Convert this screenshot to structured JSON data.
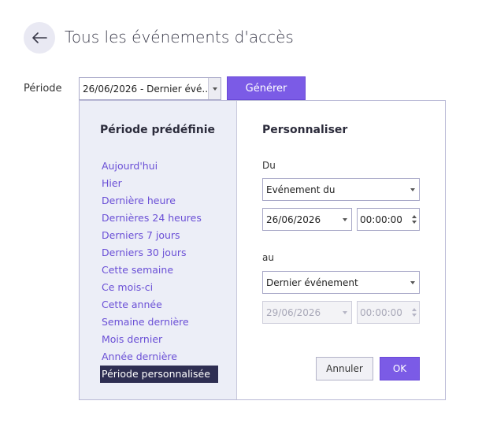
{
  "header": {
    "title": "Tous les événements d'accès",
    "back_icon": "arrow-left-icon"
  },
  "filter": {
    "period_label": "Période",
    "period_value": "26/06/2026 - Dernier évé...",
    "generate_label": "Générer"
  },
  "dropdown": {
    "presets_title": "Période prédéfinie",
    "presets": [
      "Aujourd'hui",
      "Hier",
      "Dernière heure",
      "Dernières 24 heures",
      "Derniers 7 jours",
      "Derniers 30 jours",
      "Cette semaine",
      "Ce mois-ci",
      "Cette année",
      "Semaine dernière",
      "Mois dernier",
      "Année dernière",
      "Période personnalisée"
    ],
    "selected_preset": "Période personnalisée",
    "custom": {
      "title": "Personnaliser",
      "from_label": "Du",
      "from_type": "Evénement du",
      "from_date": "26/06/2026",
      "from_time": "00:00:00",
      "to_label": "au",
      "to_type": "Dernier événement",
      "to_date": "29/06/2026",
      "to_time": "00:00:00",
      "cancel_label": "Annuler",
      "ok_label": "OK"
    }
  },
  "colors": {
    "accent": "#7b5be6",
    "link": "#6a4fd6",
    "selected_bg": "#2e2e52",
    "panel_bg": "#eceef7"
  }
}
